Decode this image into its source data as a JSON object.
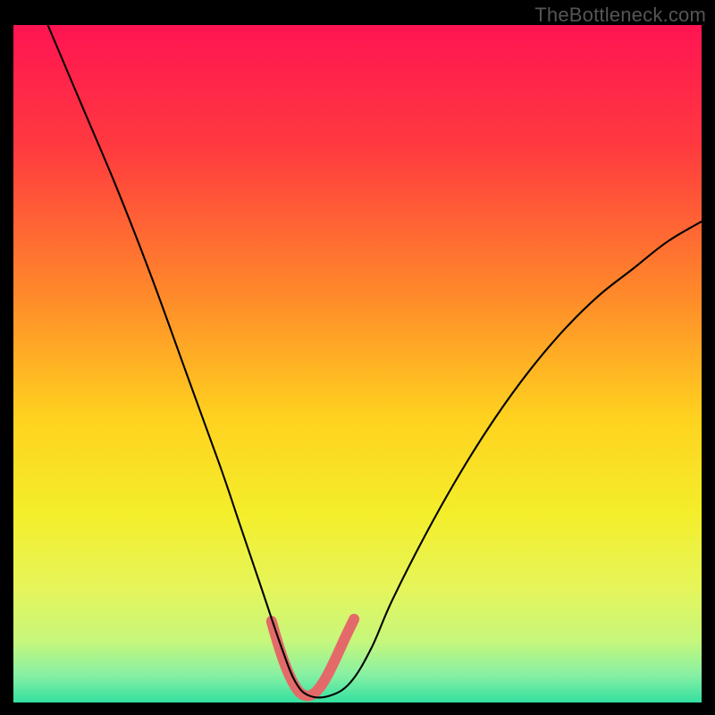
{
  "watermark": "TheBottleneck.com",
  "chart_data": {
    "type": "line",
    "title": "",
    "xlabel": "",
    "ylabel": "",
    "xlim": [
      0,
      100
    ],
    "ylim": [
      0,
      100
    ],
    "series": [
      {
        "name": "bottleneck-curve",
        "x": [
          5,
          10,
          15,
          20,
          25,
          30,
          33,
          36,
          39,
          41,
          43,
          46,
          49,
          52,
          55,
          60,
          65,
          70,
          75,
          80,
          85,
          90,
          95,
          100
        ],
        "y": [
          100,
          88,
          76,
          63,
          49,
          35,
          26,
          17,
          8,
          3,
          1,
          1,
          3,
          8,
          15,
          25,
          34,
          42,
          49,
          55,
          60,
          64,
          68,
          71
        ],
        "stroke": "#000000",
        "stroke_width": 2.1
      },
      {
        "name": "optimal-region-highlight",
        "x": [
          37.5,
          38.5,
          39.5,
          40.5,
          41.5,
          42.5,
          43.5,
          44.5,
          45.5,
          46.5,
          47.5,
          48.5,
          49.5
        ],
        "y": [
          12,
          8.5,
          5.5,
          3.2,
          1.6,
          1.0,
          1.2,
          2.2,
          3.8,
          5.8,
          8.0,
          10.2,
          12.3
        ],
        "stroke": "#e46a6a",
        "stroke_width": 12
      }
    ],
    "gradient_stops": [
      {
        "offset": 0.0,
        "color": "#ff1452"
      },
      {
        "offset": 0.18,
        "color": "#ff3a3f"
      },
      {
        "offset": 0.4,
        "color": "#ff8a2a"
      },
      {
        "offset": 0.58,
        "color": "#ffd21f"
      },
      {
        "offset": 0.72,
        "color": "#f4ee2a"
      },
      {
        "offset": 0.83,
        "color": "#e6f55a"
      },
      {
        "offset": 0.91,
        "color": "#c6f77c"
      },
      {
        "offset": 0.96,
        "color": "#86f0a3"
      },
      {
        "offset": 1.0,
        "color": "#33e0a0"
      }
    ]
  }
}
